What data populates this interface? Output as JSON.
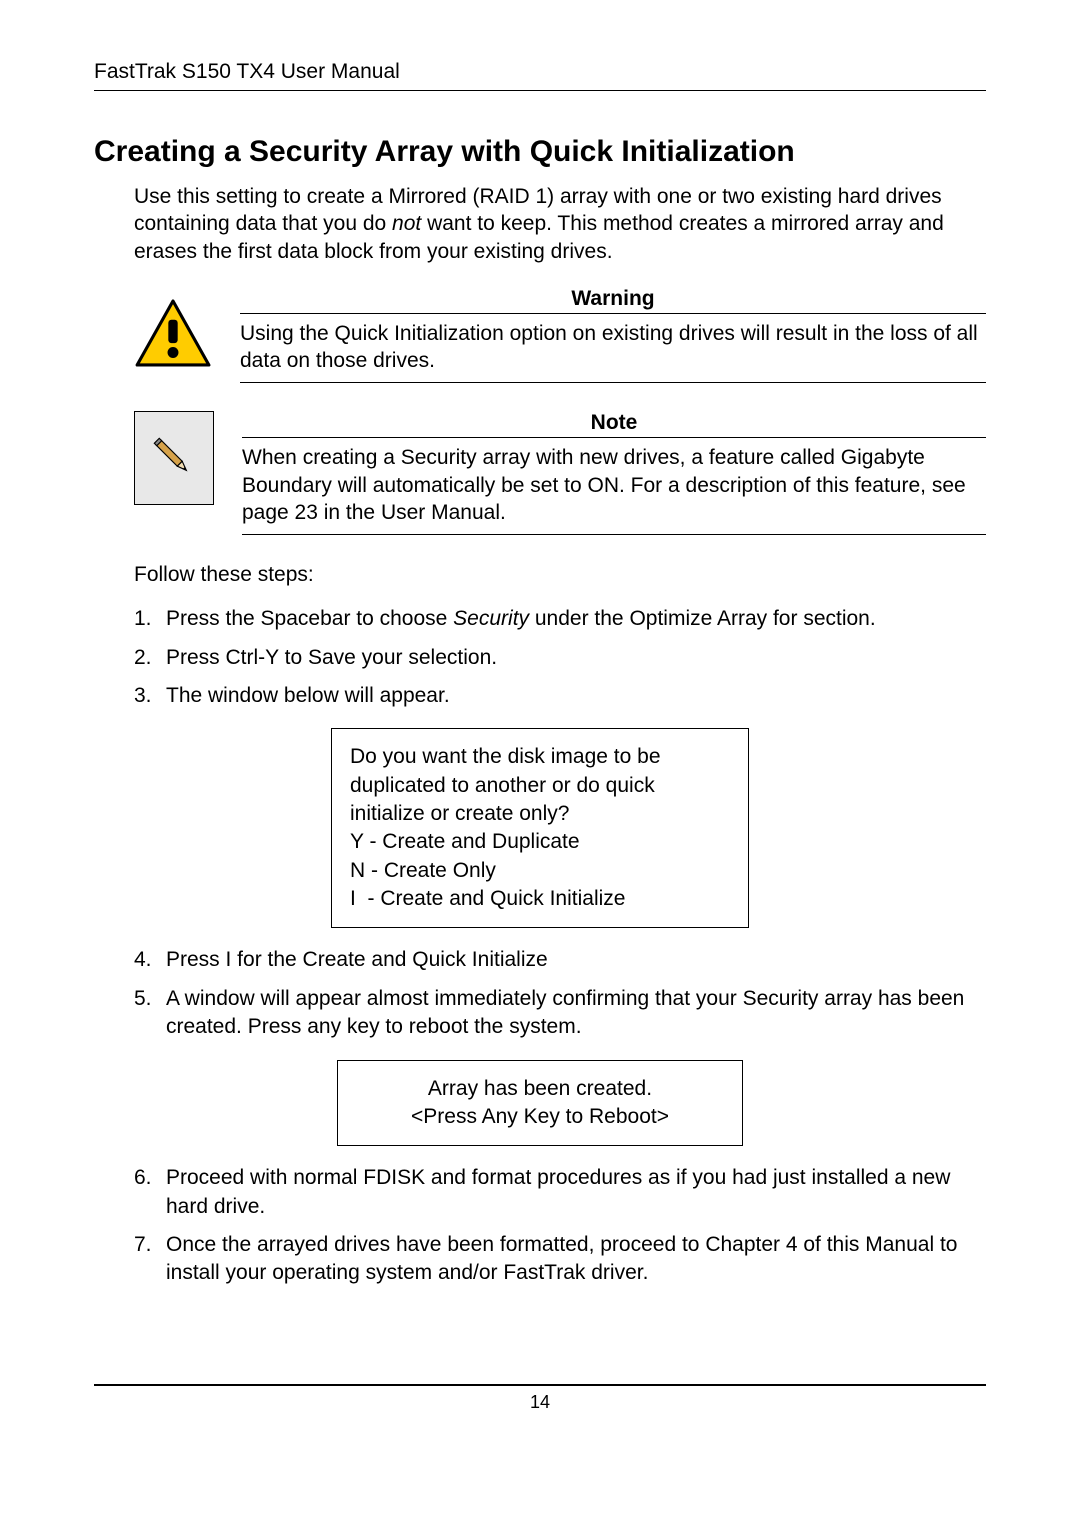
{
  "header": "FastTrak S150 TX4 User Manual",
  "heading": "Creating a Security Array with Quick Initialization",
  "intro": {
    "pre": "Use this setting to create a Mirrored (RAID 1) array with one or two existing hard drives containing data that you do ",
    "italic": "not",
    "post": " want to keep. This method creates a mirrored array and erases the first data block from your existing drives."
  },
  "warning": {
    "label": "Warning",
    "text": "Using the Quick Initialization option on existing drives will result in the loss of all data on those drives."
  },
  "note": {
    "label": "Note",
    "text": "When creating a Security array with new drives, a feature called Gigabyte Boundary will automatically be set to ON. For a description of this feature, see page 23 in the User Manual."
  },
  "follow": "Follow these steps:",
  "steps": {
    "s1": {
      "num": "1.",
      "pre": "Press the Spacebar to choose ",
      "italic": "Security",
      "post": " under the Optimize Array for section."
    },
    "s2": {
      "num": "2.",
      "text": "Press Ctrl-Y to Save your selection."
    },
    "s3": {
      "num": "3.",
      "text": "The window below will appear."
    },
    "s4": {
      "num": "4.",
      "text": "Press I for the Create and Quick Initialize"
    },
    "s5": {
      "num": "5.",
      "text": "A window will appear almost immediately confirming that your Security array has been created. Press any key to reboot the system."
    },
    "s6": {
      "num": "6.",
      "text": "Proceed with normal FDISK and format procedures as if you had just installed a new hard drive."
    },
    "s7": {
      "num": "7.",
      "text": "Once the arrayed drives have been formatted, proceed to Chapter 4 of this Manual to install your operating system and/or FastTrak driver."
    }
  },
  "prompt1": {
    "q": "Do you want the disk image to be duplicated to another or do quick initialize or create only?",
    "optY": "Y - Create and Duplicate",
    "optN": "N - Create Only",
    "optI": "I  - Create and Quick Initialize"
  },
  "prompt2": {
    "line1": "Array has been created.",
    "line2": "<Press Any Key to Reboot>"
  },
  "pageNumber": "14",
  "icons": {
    "warning": "warning-triangle-icon",
    "note": "pencil-icon"
  }
}
